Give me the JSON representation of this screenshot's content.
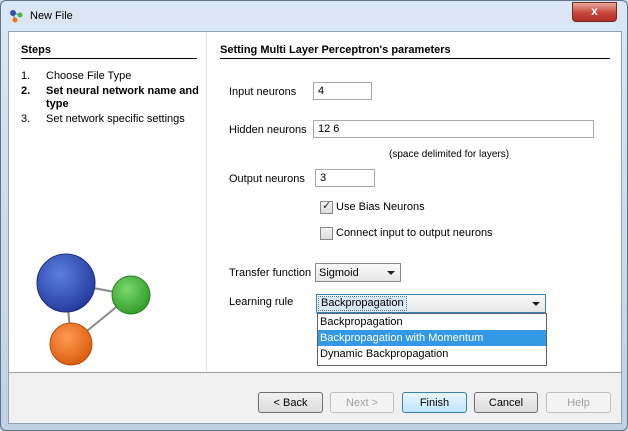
{
  "window": {
    "title": "New File",
    "close_symbol": "x"
  },
  "steps": {
    "title": "Steps",
    "items": [
      {
        "num": "1.",
        "label": "Choose File Type"
      },
      {
        "num": "2.",
        "label": "Set neural network name and type",
        "current": true
      },
      {
        "num": "3.",
        "label": "Set network specific settings"
      }
    ]
  },
  "form": {
    "title": "Setting Multi Layer Perceptron's parameters",
    "input_neurons": {
      "label": "Input neurons",
      "value": "4"
    },
    "hidden_neurons": {
      "label": "Hidden neurons",
      "value": "12 6",
      "hint": "(space delimited for layers)"
    },
    "output_neurons": {
      "label": "Output neurons",
      "value": "3"
    },
    "use_bias": {
      "label": "Use Bias Neurons",
      "checked": true
    },
    "connect_io": {
      "label": "Connect input to output neurons",
      "checked": false
    },
    "transfer_function": {
      "label": "Transfer function",
      "value": "Sigmoid"
    },
    "learning_rule": {
      "label": "Learning rule",
      "value": "Backpropagation",
      "options": [
        "Backpropagation",
        "Backpropagation with Momentum",
        "Dynamic Backpropagation"
      ],
      "highlighted": "Backpropagation with Momentum"
    }
  },
  "buttons": {
    "back": "< Back",
    "next": "Next >",
    "finish": "Finish",
    "cancel": "Cancel",
    "help": "Help"
  },
  "colors": {
    "accent": "#3399e6",
    "node_blue": "#2f4fb4",
    "node_green": "#46b93a",
    "node_orange": "#ef6f1a"
  }
}
